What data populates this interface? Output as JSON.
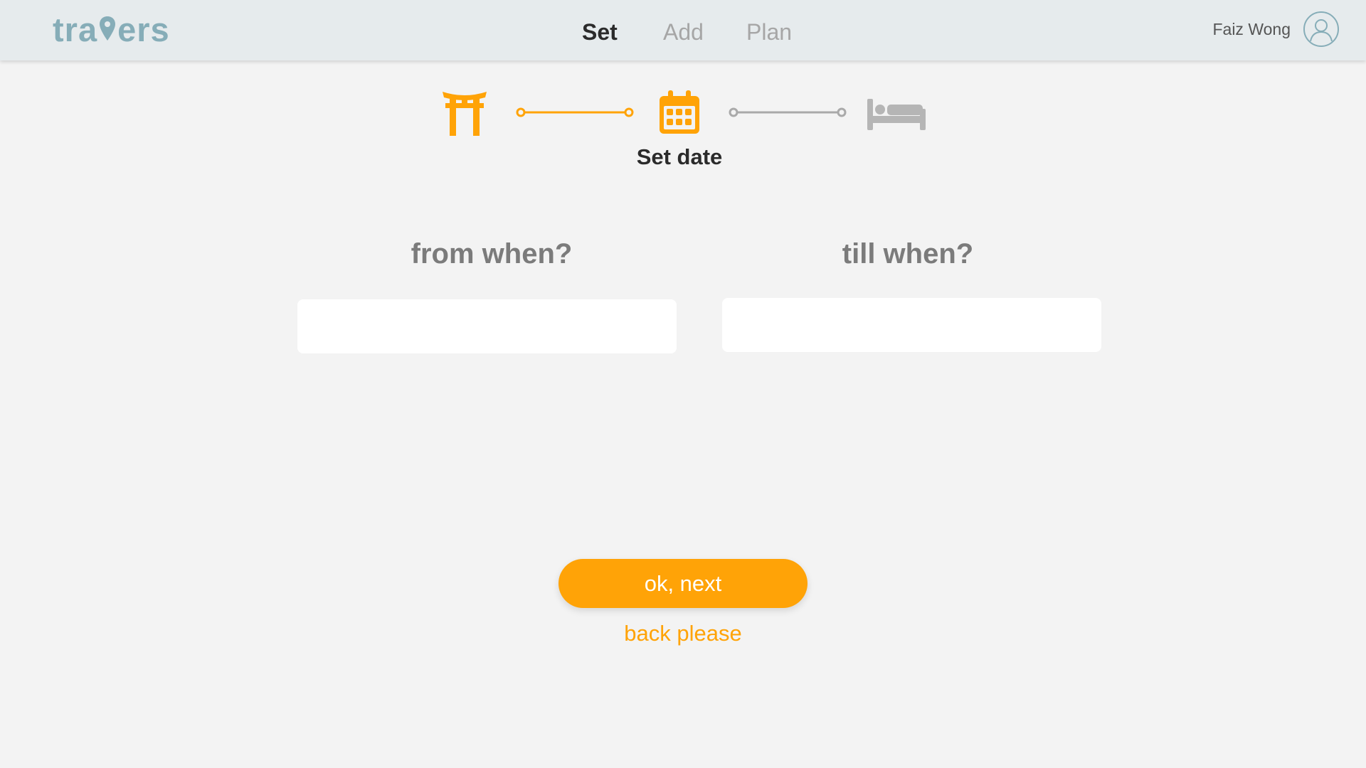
{
  "app": {
    "logo_prefix": "tra",
    "logo_suffix": "ers",
    "brand_color": "#86adb8",
    "accent_color": "#ffa307"
  },
  "nav": {
    "items": [
      {
        "label": "Set",
        "active": true
      },
      {
        "label": "Add",
        "active": false
      },
      {
        "label": "Plan",
        "active": false
      }
    ]
  },
  "user": {
    "name": "Faiz Wong",
    "avatar_icon": "user-outline-icon"
  },
  "stepper": {
    "steps": [
      {
        "icon": "torii-gate-icon",
        "state": "done"
      },
      {
        "icon": "calendar-icon",
        "state": "current"
      },
      {
        "icon": "bed-icon",
        "state": "pending"
      }
    ],
    "current_label": "Set date"
  },
  "form": {
    "from_title": "from when?",
    "till_title": "till when?",
    "from_value": "",
    "till_value": ""
  },
  "actions": {
    "next_label": "ok, next",
    "back_label": "back please"
  }
}
